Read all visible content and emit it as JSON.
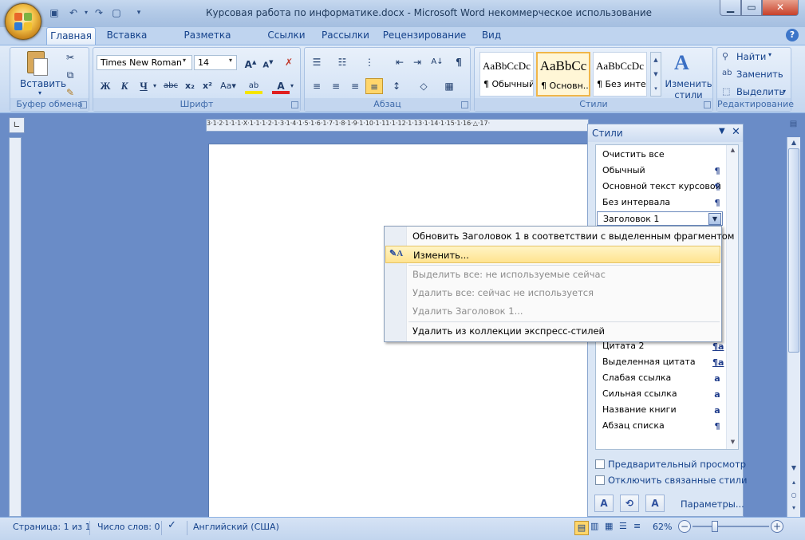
{
  "window": {
    "title": "Курсовая работа по информатике.docx - Microsoft Word некоммерческое использование"
  },
  "tabs": [
    {
      "label": "Главная"
    },
    {
      "label": "Вставка"
    },
    {
      "label": "Разметка страницы"
    },
    {
      "label": "Ссылки"
    },
    {
      "label": "Рассылки"
    },
    {
      "label": "Рецензирование"
    },
    {
      "label": "Вид"
    }
  ],
  "ribbon": {
    "clipboard": {
      "label": "Буфер обмена",
      "paste_label": "Вставить"
    },
    "font": {
      "label": "Шрифт",
      "font_name": "Times New Roman",
      "font_size": "14",
      "bold": "Ж",
      "italic": "К",
      "underline": "Ч"
    },
    "paragraph": {
      "label": "Абзац"
    },
    "styles": {
      "label": "Стили",
      "gallery": [
        {
          "sample": "AaBbCcDc",
          "name": "¶ Обычный"
        },
        {
          "sample": "AaBbCc",
          "name": "¶ Основн..."
        },
        {
          "sample": "AaBbCcDc",
          "name": "¶ Без инте..."
        }
      ],
      "change_label_1": "Изменить",
      "change_label_2": "стили"
    },
    "editing": {
      "label": "Редактирование",
      "find": "Найти",
      "replace": "Заменить",
      "select": "Выделить"
    }
  },
  "styles_pane": {
    "title": "Стили",
    "items": [
      {
        "name": "Очистить все",
        "mark": ""
      },
      {
        "name": "Обычный",
        "mark": "¶"
      },
      {
        "name": "Основной текст курсовой",
        "mark": "¶"
      },
      {
        "name": "Без интервала",
        "mark": "¶"
      },
      {
        "name": "Заголовок 1",
        "mark": ""
      },
      {
        "name": "Цитата 2",
        "mark": "¶a"
      },
      {
        "name": "Выделенная цитата",
        "mark": "¶a"
      },
      {
        "name": "Слабая ссылка",
        "mark": "a"
      },
      {
        "name": "Сильная ссылка",
        "mark": "a"
      },
      {
        "name": "Название книги",
        "mark": "a"
      },
      {
        "name": "Абзац списка",
        "mark": "¶"
      }
    ],
    "preview_label": "Предварительный просмотр",
    "linked_label": "Отключить связанные стили",
    "options_link": "Параметры..."
  },
  "context_menu": {
    "items": [
      {
        "label": "Обновить Заголовок 1 в соответствии с выделенным фрагментом",
        "state": "normal"
      },
      {
        "label": "Изменить...",
        "state": "highlighted"
      },
      {
        "label": "Выделить все: не используемые сейчас",
        "state": "disabled"
      },
      {
        "label": "Удалить все: сейчас не используется",
        "state": "disabled"
      },
      {
        "label": "Удалить Заголовок 1...",
        "state": "disabled"
      },
      {
        "label": "Удалить из коллекции экспресс-стилей",
        "state": "normal"
      }
    ]
  },
  "status": {
    "page": "Страница: 1 из 1",
    "words": "Число слов: 0",
    "language": "Английский (США)",
    "zoom": "62%"
  },
  "ruler": {
    "labels": "3·1·2·1·1·1·Х·1·1·1·2·1·3·1·4·1·5·1·6·1·7·1·8·1·9·1·10·1·11·1·12·1·13·1·14·1·15·1·16·△·17·"
  }
}
